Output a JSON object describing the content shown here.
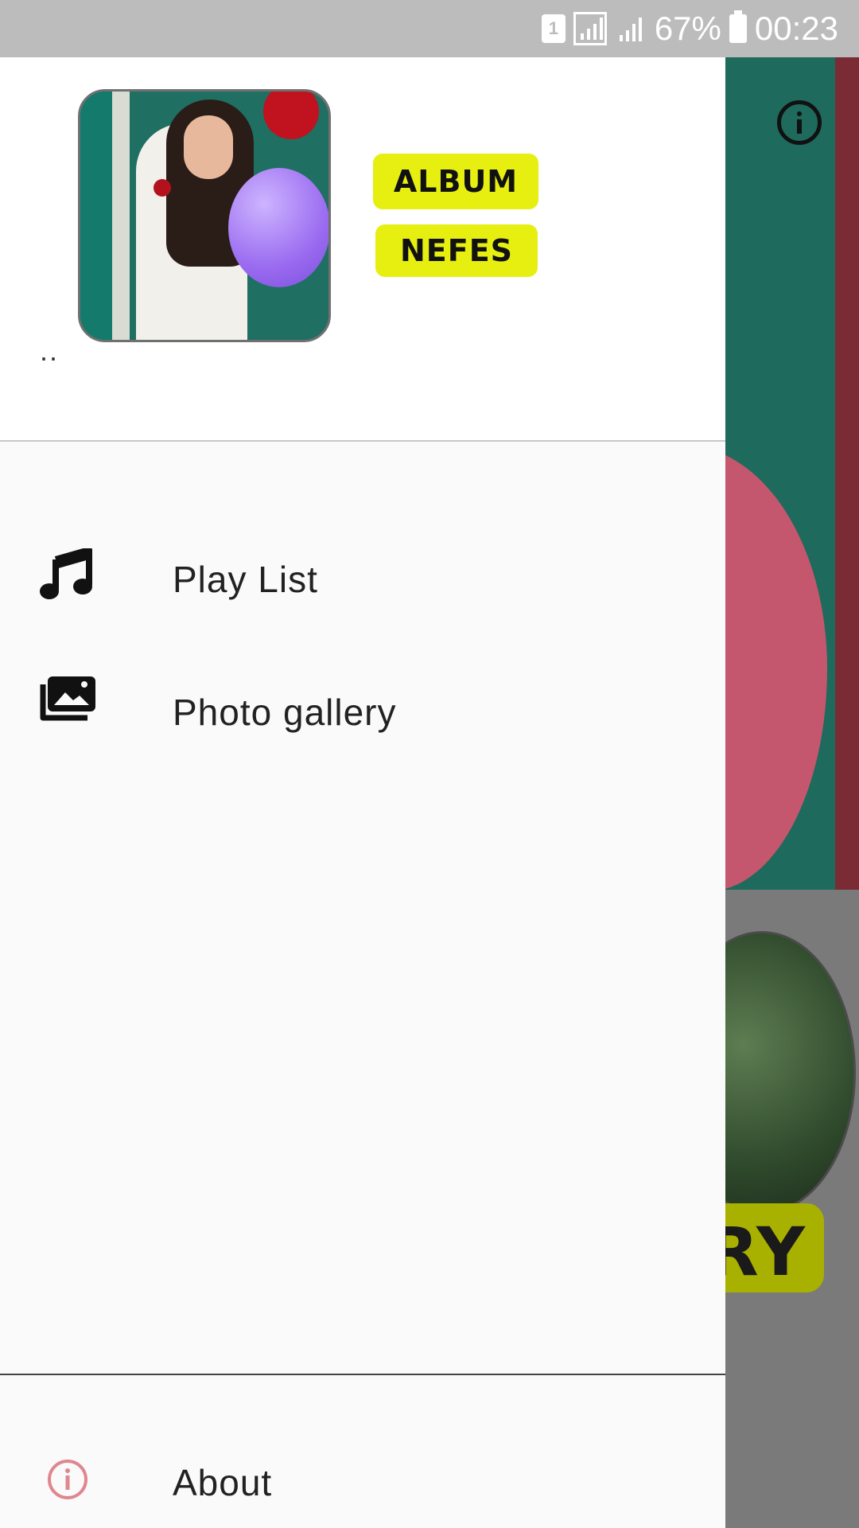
{
  "status_bar": {
    "sim_slot": "1",
    "battery_percent": "67%",
    "time": "00:23"
  },
  "drawer": {
    "header": {
      "album_label": "ALBUM",
      "artist_label": "NEFES",
      "subtitle": ".."
    },
    "menu_items": [
      {
        "label": "Play List",
        "icon": "music-note-icon"
      },
      {
        "label": "Photo gallery",
        "icon": "photo-gallery-icon"
      }
    ],
    "footer_items": [
      {
        "label": "About",
        "icon": "info-icon"
      }
    ]
  },
  "background_app": {
    "partial_button_text": "RY",
    "colors": {
      "top_panel": "#1e6a5d",
      "gallery_pill": "#a8b000"
    }
  },
  "colors": {
    "drawer_bg": "#fafafa",
    "header_pill": "#e6ef10",
    "about_icon": "#e0868f",
    "status_bar": "#bcbcbc"
  }
}
